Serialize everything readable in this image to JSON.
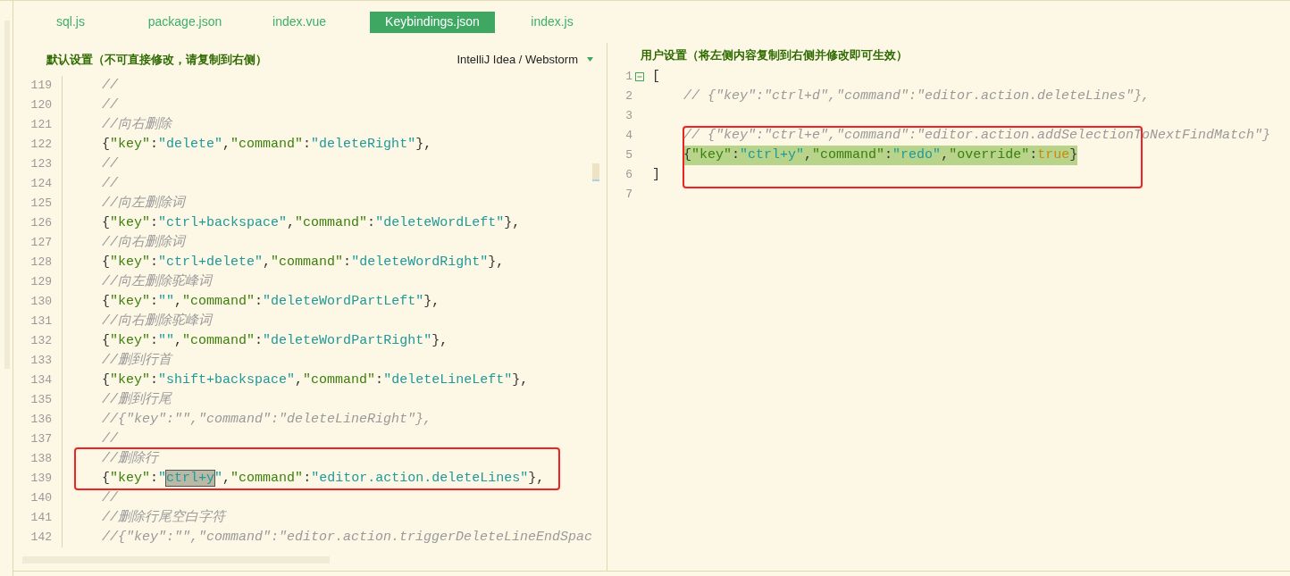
{
  "tabs": [
    {
      "label": "sql.js",
      "selected": false
    },
    {
      "label": "package.json",
      "selected": false
    },
    {
      "label": "index.vue",
      "selected": false
    },
    {
      "label": "Keybindings.json",
      "selected": true
    },
    {
      "label": "index.js",
      "selected": false
    }
  ],
  "default_settings": {
    "title": "默认设置（不可直接修改，请复制到右侧）",
    "preset_dropdown": "IntelliJ Idea / Webstorm",
    "blocks": [
      {
        "boxed": false,
        "lines": [
          {
            "number": "119",
            "tokens": [
              {
                "kind": "comment",
                "text": "//"
              }
            ]
          },
          {
            "number": "120",
            "tokens": [
              {
                "kind": "comment",
                "text": "//"
              }
            ]
          },
          {
            "number": "121",
            "tokens": [
              {
                "kind": "comment",
                "text": "//向右删除"
              }
            ]
          },
          {
            "number": "122",
            "tokens": [
              {
                "kind": "punct",
                "text": "{"
              },
              {
                "kind": "key",
                "text": "\"key\""
              },
              {
                "kind": "punct",
                "text": ":"
              },
              {
                "kind": "string",
                "text": "\"delete\""
              },
              {
                "kind": "punct",
                "text": ","
              },
              {
                "kind": "key",
                "text": "\"command\""
              },
              {
                "kind": "punct",
                "text": ":"
              },
              {
                "kind": "string",
                "text": "\"deleteRight\""
              },
              {
                "kind": "punct",
                "text": "},"
              }
            ]
          },
          {
            "number": "123",
            "tokens": [
              {
                "kind": "comment",
                "text": "//"
              }
            ]
          },
          {
            "number": "124",
            "tokens": [
              {
                "kind": "comment",
                "text": "//"
              }
            ]
          },
          {
            "number": "125",
            "tokens": [
              {
                "kind": "comment",
                "text": "//向左删除词"
              }
            ]
          },
          {
            "number": "126",
            "tokens": [
              {
                "kind": "punct",
                "text": "{"
              },
              {
                "kind": "key",
                "text": "\"key\""
              },
              {
                "kind": "punct",
                "text": ":"
              },
              {
                "kind": "string",
                "text": "\"ctrl+backspace\""
              },
              {
                "kind": "punct",
                "text": ","
              },
              {
                "kind": "key",
                "text": "\"command\""
              },
              {
                "kind": "punct",
                "text": ":"
              },
              {
                "kind": "string",
                "text": "\"deleteWordLeft\""
              },
              {
                "kind": "punct",
                "text": "},"
              }
            ]
          },
          {
            "number": "127",
            "tokens": [
              {
                "kind": "comment",
                "text": "//向右删除词"
              }
            ]
          },
          {
            "number": "128",
            "tokens": [
              {
                "kind": "punct",
                "text": "{"
              },
              {
                "kind": "key",
                "text": "\"key\""
              },
              {
                "kind": "punct",
                "text": ":"
              },
              {
                "kind": "string",
                "text": "\"ctrl+delete\""
              },
              {
                "kind": "punct",
                "text": ","
              },
              {
                "kind": "key",
                "text": "\"command\""
              },
              {
                "kind": "punct",
                "text": ":"
              },
              {
                "kind": "string",
                "text": "\"deleteWordRight\""
              },
              {
                "kind": "punct",
                "text": "},"
              }
            ]
          },
          {
            "number": "129",
            "tokens": [
              {
                "kind": "comment",
                "text": "//向左删除驼峰词"
              }
            ]
          },
          {
            "number": "130",
            "tokens": [
              {
                "kind": "punct",
                "text": "{"
              },
              {
                "kind": "key",
                "text": "\"key\""
              },
              {
                "kind": "punct",
                "text": ":"
              },
              {
                "kind": "string",
                "text": "\"\""
              },
              {
                "kind": "punct",
                "text": ","
              },
              {
                "kind": "key",
                "text": "\"command\""
              },
              {
                "kind": "punct",
                "text": ":"
              },
              {
                "kind": "string",
                "text": "\"deleteWordPartLeft\""
              },
              {
                "kind": "punct",
                "text": "},"
              }
            ]
          },
          {
            "number": "131",
            "tokens": [
              {
                "kind": "comment",
                "text": "//向右删除驼峰词"
              }
            ]
          },
          {
            "number": "132",
            "tokens": [
              {
                "kind": "punct",
                "text": "{"
              },
              {
                "kind": "key",
                "text": "\"key\""
              },
              {
                "kind": "punct",
                "text": ":"
              },
              {
                "kind": "string",
                "text": "\"\""
              },
              {
                "kind": "punct",
                "text": ","
              },
              {
                "kind": "key",
                "text": "\"command\""
              },
              {
                "kind": "punct",
                "text": ":"
              },
              {
                "kind": "string",
                "text": "\"deleteWordPartRight\""
              },
              {
                "kind": "punct",
                "text": "},"
              }
            ]
          },
          {
            "number": "133",
            "tokens": [
              {
                "kind": "comment",
                "text": "//删到行首"
              }
            ]
          },
          {
            "number": "134",
            "tokens": [
              {
                "kind": "punct",
                "text": "{"
              },
              {
                "kind": "key",
                "text": "\"key\""
              },
              {
                "kind": "punct",
                "text": ":"
              },
              {
                "kind": "string",
                "text": "\"shift+backspace\""
              },
              {
                "kind": "punct",
                "text": ","
              },
              {
                "kind": "key",
                "text": "\"command\""
              },
              {
                "kind": "punct",
                "text": ":"
              },
              {
                "kind": "string",
                "text": "\"deleteLineLeft\""
              },
              {
                "kind": "punct",
                "text": "},"
              }
            ]
          },
          {
            "number": "135",
            "tokens": [
              {
                "kind": "comment",
                "text": "//删到行尾"
              }
            ]
          },
          {
            "number": "136",
            "tokens": [
              {
                "kind": "comment",
                "text": "//{\"key\":\"\",\"command\":\"deleteLineRight\"},"
              }
            ]
          },
          {
            "number": "137",
            "tokens": [
              {
                "kind": "comment",
                "text": "//"
              }
            ]
          }
        ]
      },
      {
        "boxed": true,
        "lines": [
          {
            "number": "138",
            "tokens": [
              {
                "kind": "comment",
                "text": "//删除行"
              }
            ]
          },
          {
            "number": "139",
            "tokens": [
              {
                "kind": "punct",
                "text": "{"
              },
              {
                "kind": "key",
                "text": "\"key\""
              },
              {
                "kind": "punct",
                "text": ":"
              },
              {
                "kind": "string",
                "text": "\""
              },
              {
                "kind": "selection",
                "text": "ctrl+y"
              },
              {
                "kind": "string",
                "text": "\""
              },
              {
                "kind": "punct",
                "text": ","
              },
              {
                "kind": "key",
                "text": "\"command\""
              },
              {
                "kind": "punct",
                "text": ":"
              },
              {
                "kind": "string",
                "text": "\"editor.action.deleteLines\""
              },
              {
                "kind": "punct",
                "text": "},"
              }
            ]
          }
        ]
      },
      {
        "boxed": false,
        "lines": [
          {
            "number": "140",
            "tokens": [
              {
                "kind": "comment",
                "text": "//"
              }
            ]
          },
          {
            "number": "141",
            "tokens": [
              {
                "kind": "comment",
                "text": "//删除行尾空白字符"
              }
            ]
          },
          {
            "number": "142",
            "tokens": [
              {
                "kind": "comment",
                "text": "//{\"key\":\"\",\"command\":\"editor.action.triggerDeleteLineEndSpac"
              }
            ]
          }
        ]
      }
    ]
  },
  "user_settings": {
    "title": "用户设置（将左侧内容复制到右侧并修改即可生效）",
    "blocks": [
      {
        "boxed": false,
        "lines": [
          {
            "number": "1",
            "indent": false,
            "tokens": [
              {
                "kind": "punct",
                "text": "["
              }
            ]
          },
          {
            "number": "2",
            "indent": true,
            "tokens": [
              {
                "kind": "comment",
                "text": "// {\"key\":\"ctrl+d\",\"command\":\"editor.action.deleteLines\"},"
              }
            ]
          },
          {
            "number": "3"
          }
        ]
      },
      {
        "boxed": true,
        "lines": [
          {
            "number": "4",
            "indent": true,
            "tokens": [
              {
                "kind": "comment",
                "text": "// {\"key\":\"ctrl+e\",\"command\":\"editor.action.addSelectionToNextFindMatch\"}"
              }
            ]
          },
          {
            "number": "5",
            "indent": true,
            "highlighted": true,
            "tokens": [
              {
                "kind": "punct",
                "text": "{"
              },
              {
                "kind": "key",
                "text": "\"key\""
              },
              {
                "kind": "punct",
                "text": ":"
              },
              {
                "kind": "string",
                "text": "\"ctrl+y\""
              },
              {
                "kind": "punct",
                "text": ","
              },
              {
                "kind": "key",
                "text": "\"command\""
              },
              {
                "kind": "punct",
                "text": ":"
              },
              {
                "kind": "string",
                "text": "\"redo\""
              },
              {
                "kind": "punct",
                "text": ","
              },
              {
                "kind": "key",
                "text": "\"override\""
              },
              {
                "kind": "punct",
                "text": ":"
              },
              {
                "kind": "boolean",
                "text": "true"
              },
              {
                "kind": "punct",
                "text": "}"
              }
            ]
          },
          {
            "number": "6",
            "indent": false,
            "tokens": [
              {
                "kind": "punct",
                "text": "]"
              }
            ]
          }
        ]
      },
      {
        "boxed": false,
        "lines": [
          {
            "number": "7"
          }
        ]
      }
    ]
  }
}
